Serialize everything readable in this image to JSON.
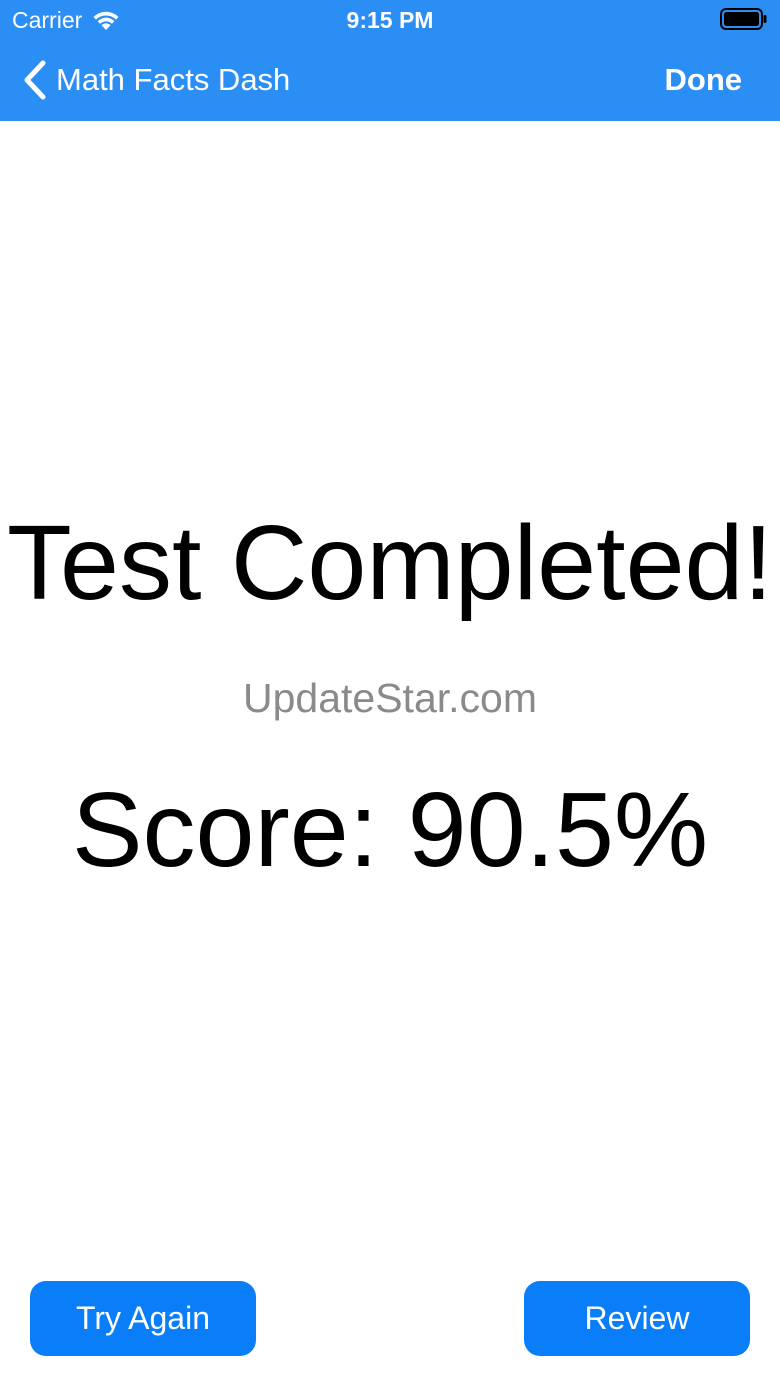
{
  "status_bar": {
    "carrier": "Carrier",
    "time": "9:15 PM",
    "icons": [
      "wifi-icon",
      "battery-icon"
    ]
  },
  "nav": {
    "back_label": "Math Facts Dash",
    "back_icon": "chevron-left-icon",
    "done_label": "Done"
  },
  "main": {
    "title": "Test Completed!",
    "watermark": "UpdateStar.com",
    "score": "Score: 90.5%"
  },
  "actions": {
    "try_again_label": "Try Again",
    "review_label": "Review"
  },
  "colors": {
    "nav_background": "#2b8ef5",
    "button_background": "#0a7ef8",
    "watermark_text": "#8a8a8a"
  }
}
